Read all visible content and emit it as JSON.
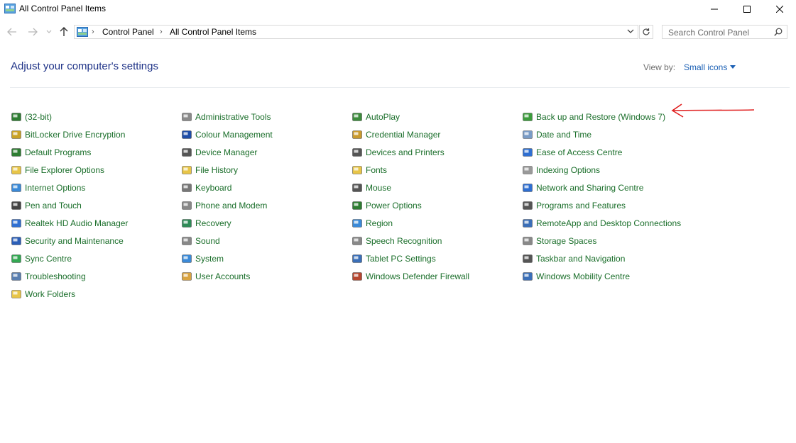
{
  "window": {
    "title": "All Control Panel Items"
  },
  "address": {
    "crumbs": [
      "Control Panel",
      "All Control Panel Items"
    ],
    "search_placeholder": "Search Control Panel"
  },
  "header": {
    "title": "Adjust your computer's settings",
    "view_by_label": "View by:",
    "view_by_value": "Small icons"
  },
  "columns": [
    {
      "items": [
        {
          "label": "(32-bit)",
          "icon": "java-icon",
          "color": "#2e7d32"
        },
        {
          "label": "BitLocker Drive Encryption",
          "icon": "bitlocker-icon",
          "color": "#c9a227"
        },
        {
          "label": "Default Programs",
          "icon": "default-programs-icon",
          "color": "#2e7d32"
        },
        {
          "label": "File Explorer Options",
          "icon": "folder-options-icon",
          "color": "#e8c547"
        },
        {
          "label": "Internet Options",
          "icon": "internet-options-icon",
          "color": "#3b8ad8"
        },
        {
          "label": "Pen and Touch",
          "icon": "pen-icon",
          "color": "#444444"
        },
        {
          "label": "Realtek HD Audio Manager",
          "icon": "realtek-icon",
          "color": "#2f6fd1"
        },
        {
          "label": "Security and Maintenance",
          "icon": "flag-icon",
          "color": "#2c5fb8"
        },
        {
          "label": "Sync Centre",
          "icon": "sync-icon",
          "color": "#34a853"
        },
        {
          "label": "Troubleshooting",
          "icon": "troubleshooting-icon",
          "color": "#5a7fb0"
        },
        {
          "label": "Work Folders",
          "icon": "work-folders-icon",
          "color": "#e8c547"
        }
      ]
    },
    {
      "items": [
        {
          "label": "Administrative Tools",
          "icon": "admin-tools-icon",
          "color": "#8a8a8a"
        },
        {
          "label": "Colour Management",
          "icon": "colour-management-icon",
          "color": "#1f4ea8"
        },
        {
          "label": "Device Manager",
          "icon": "device-manager-icon",
          "color": "#555555"
        },
        {
          "label": "File History",
          "icon": "file-history-icon",
          "color": "#e8c547"
        },
        {
          "label": "Keyboard",
          "icon": "keyboard-icon",
          "color": "#777777"
        },
        {
          "label": "Phone and Modem",
          "icon": "phone-modem-icon",
          "color": "#888888"
        },
        {
          "label": "Recovery",
          "icon": "recovery-icon",
          "color": "#2e8b57"
        },
        {
          "label": "Sound",
          "icon": "sound-icon",
          "color": "#888888"
        },
        {
          "label": "System",
          "icon": "system-icon",
          "color": "#3b8ad8"
        },
        {
          "label": "User Accounts",
          "icon": "user-accounts-icon",
          "color": "#d9a441"
        }
      ]
    },
    {
      "items": [
        {
          "label": "AutoPlay",
          "icon": "autoplay-icon",
          "color": "#3c8c3c"
        },
        {
          "label": "Credential Manager",
          "icon": "credential-manager-icon",
          "color": "#c99a2e"
        },
        {
          "label": "Devices and Printers",
          "icon": "devices-printers-icon",
          "color": "#555555"
        },
        {
          "label": "Fonts",
          "icon": "fonts-icon",
          "color": "#e8c547"
        },
        {
          "label": "Mouse",
          "icon": "mouse-icon",
          "color": "#555555"
        },
        {
          "label": "Power Options",
          "icon": "power-options-icon",
          "color": "#2e7d32"
        },
        {
          "label": "Region",
          "icon": "region-icon",
          "color": "#3b8ad8"
        },
        {
          "label": "Speech Recognition",
          "icon": "microphone-icon",
          "color": "#888888"
        },
        {
          "label": "Tablet PC Settings",
          "icon": "tablet-icon",
          "color": "#3b6fb8"
        },
        {
          "label": "Windows Defender Firewall",
          "icon": "firewall-icon",
          "color": "#b5462f"
        }
      ]
    },
    {
      "items": [
        {
          "label": "Back up and Restore (Windows 7)",
          "icon": "backup-restore-icon",
          "color": "#3c9c3c"
        },
        {
          "label": "Date and Time",
          "icon": "date-time-icon",
          "color": "#7a9cc6"
        },
        {
          "label": "Ease of Access Centre",
          "icon": "ease-of-access-icon",
          "color": "#2f6fd1"
        },
        {
          "label": "Indexing Options",
          "icon": "indexing-icon",
          "color": "#999999"
        },
        {
          "label": "Network and Sharing Centre",
          "icon": "network-icon",
          "color": "#2f6fd1"
        },
        {
          "label": "Programs and Features",
          "icon": "programs-features-icon",
          "color": "#555555"
        },
        {
          "label": "RemoteApp and Desktop Connections",
          "icon": "remoteapp-icon",
          "color": "#3b6fb8"
        },
        {
          "label": "Storage Spaces",
          "icon": "storage-spaces-icon",
          "color": "#888888"
        },
        {
          "label": "Taskbar and Navigation",
          "icon": "taskbar-icon",
          "color": "#555555"
        },
        {
          "label": "Windows Mobility Centre",
          "icon": "mobility-centre-icon",
          "color": "#3b6fb8"
        }
      ]
    }
  ],
  "colors": {
    "link_green": "#1a6e2a",
    "title_blue": "#1e3287",
    "accent_blue": "#1a5fb4",
    "annotation_red": "#e02020"
  }
}
